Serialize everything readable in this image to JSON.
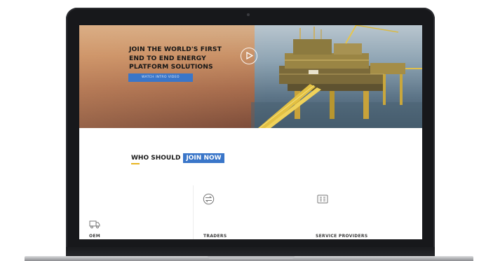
{
  "hero": {
    "title": "JOIN THE WORLD'S FIRST\nEND TO END ENERGY\nPLATFORM SOLUTIONS",
    "watch_button": "WATCH INTRO VIDEO"
  },
  "section": {
    "heading_prefix": "WHO SHOULD",
    "heading_highlight": "JOIN NOW"
  },
  "categories": [
    {
      "label": "OEM",
      "icon": "truck-icon"
    },
    {
      "label": "TRADERS",
      "icon": "exchange-icon"
    },
    {
      "label": "SERVICE PROVIDERS",
      "icon": "id-card-icon"
    }
  ],
  "colors": {
    "accent": "#3a76c9",
    "underline": "#e8b520"
  }
}
